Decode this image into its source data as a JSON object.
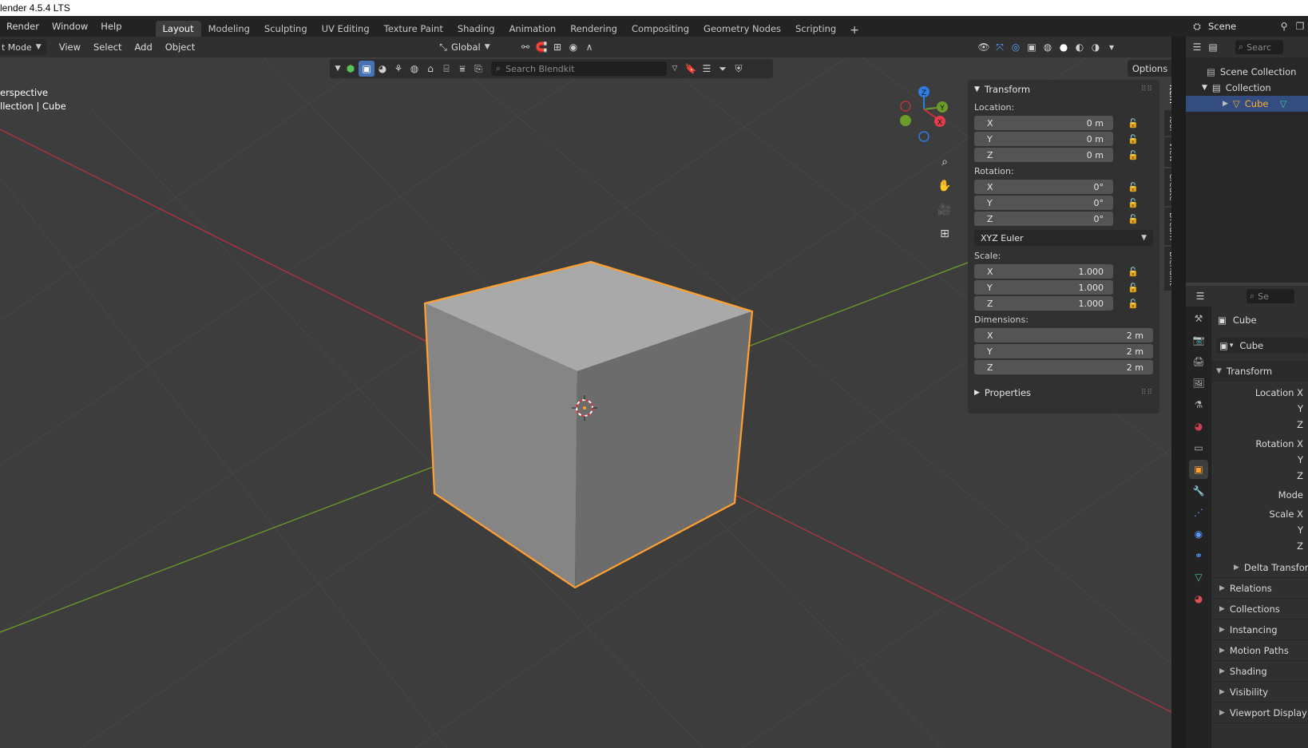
{
  "window": {
    "title": "lender 4.5.4 LTS"
  },
  "menu": [
    "Render",
    "Window",
    "Help"
  ],
  "workspaces": [
    {
      "label": "Layout",
      "active": true
    },
    {
      "label": "Modeling"
    },
    {
      "label": "Sculpting"
    },
    {
      "label": "UV Editing"
    },
    {
      "label": "Texture Paint"
    },
    {
      "label": "Shading"
    },
    {
      "label": "Animation"
    },
    {
      "label": "Rendering"
    },
    {
      "label": "Compositing"
    },
    {
      "label": "Geometry Nodes"
    },
    {
      "label": "Scripting"
    }
  ],
  "scene": {
    "label": "Scene"
  },
  "viewport_header": {
    "mode": "t Mode",
    "menus": [
      "View",
      "Select",
      "Add",
      "Object"
    ],
    "orientation": "Global"
  },
  "blendkit": {
    "search_placeholder": "Search Blendkit"
  },
  "options_label": "Options",
  "viewport_info": {
    "view": "erspective",
    "collection": "llection | Cube"
  },
  "gizmo": {
    "x": "X",
    "y": "Y",
    "z": "Z"
  },
  "npanel": {
    "transform_title": "Transform",
    "location_label": "Location:",
    "location": [
      {
        "axis": "X",
        "value": "0 m"
      },
      {
        "axis": "Y",
        "value": "0 m"
      },
      {
        "axis": "Z",
        "value": "0 m"
      }
    ],
    "rotation_label": "Rotation:",
    "rotation": [
      {
        "axis": "X",
        "value": "0°"
      },
      {
        "axis": "Y",
        "value": "0°"
      },
      {
        "axis": "Z",
        "value": "0°"
      }
    ],
    "rotation_mode": "XYZ Euler",
    "scale_label": "Scale:",
    "scale": [
      {
        "axis": "X",
        "value": "1.000"
      },
      {
        "axis": "Y",
        "value": "1.000"
      },
      {
        "axis": "Z",
        "value": "1.000"
      }
    ],
    "dimensions_label": "Dimensions:",
    "dimensions": [
      {
        "axis": "X",
        "value": "2 m"
      },
      {
        "axis": "Y",
        "value": "2 m"
      },
      {
        "axis": "Z",
        "value": "2 m"
      }
    ],
    "properties_title": "Properties"
  },
  "side_tabs": [
    "Item",
    "Tool",
    "View",
    "Create",
    "Dream",
    "Blendkit"
  ],
  "outliner": {
    "search_placeholder": "Searc",
    "rows": [
      "Scene Collection",
      "Collection",
      "Cube"
    ]
  },
  "properties": {
    "search_placeholder": "Se",
    "object_name": "Cube",
    "data_name": "Cube",
    "transform_title": "Transform",
    "rows": [
      "Location X",
      "Y",
      "Z",
      "Rotation X",
      "Y",
      "Z",
      "Mode",
      "Scale X",
      "Y",
      "Z"
    ],
    "sections": [
      "Delta Transform",
      "Relations",
      "Collections",
      "Instancing",
      "Motion Paths",
      "Shading",
      "Visibility",
      "Viewport Display"
    ]
  },
  "colors": {
    "selection_orange": "#ffa030",
    "axis_red": "#c5333a",
    "axis_green": "#6b9c2a",
    "axis_blue": "#2f7de1"
  }
}
